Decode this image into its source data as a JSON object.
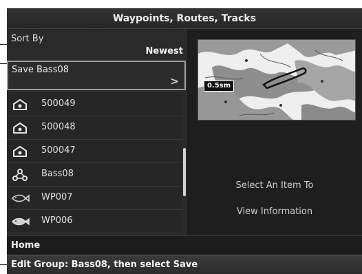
{
  "window": {
    "title": "Waypoints, Routes, Tracks"
  },
  "sort": {
    "label": "Sort By",
    "value": "Newest"
  },
  "save": {
    "label": "Save Bass08",
    "chevron": ">"
  },
  "list": {
    "items": [
      {
        "label": "500049",
        "icon": "home-waypoint-icon"
      },
      {
        "label": "500048",
        "icon": "home-waypoint-icon"
      },
      {
        "label": "500047",
        "icon": "home-waypoint-icon"
      },
      {
        "label": "Bass08",
        "icon": "group-icon"
      },
      {
        "label": "WP007",
        "icon": "fish-icon"
      },
      {
        "label": "WP006",
        "icon": "fish-icon"
      }
    ],
    "scroll_fraction": 0.6
  },
  "map": {
    "scale_label": "0.5sm"
  },
  "info": {
    "line1": "Select An Item To",
    "line2": "View Information"
  },
  "home": {
    "label": "Home"
  },
  "status": {
    "text": "Edit Group: Bass08, then select Save"
  },
  "colors": {
    "background": "#202020",
    "highlight_border": "#9a9a9a",
    "text": "#e6e6e6"
  }
}
